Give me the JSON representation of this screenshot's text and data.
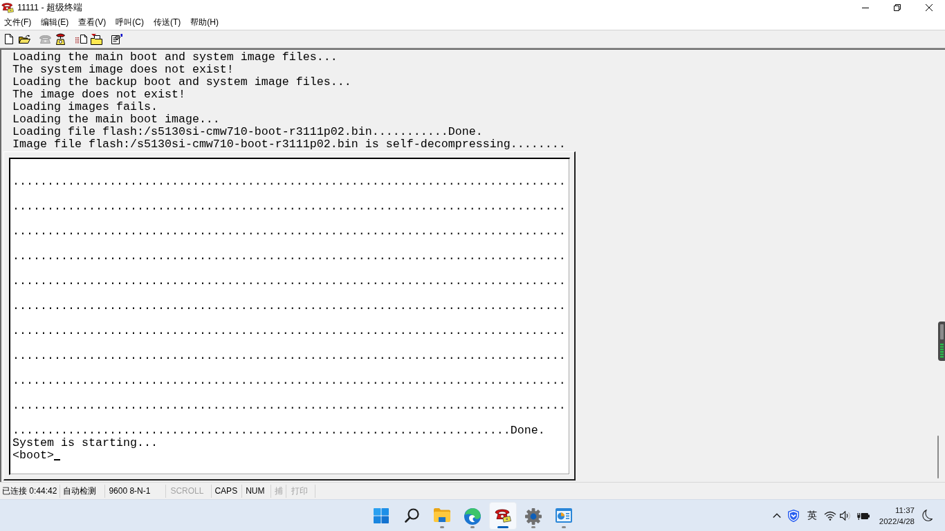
{
  "window": {
    "title": "11111 - 超级终端"
  },
  "menu": [
    "文件(F)",
    "编辑(E)",
    "查看(V)",
    "呼叫(C)",
    "传送(T)",
    "帮助(H)"
  ],
  "toolbar": {
    "groups": [
      [
        {
          "kind": "new",
          "disabled": false
        },
        {
          "kind": "open",
          "disabled": false
        }
      ],
      [
        {
          "kind": "call",
          "disabled": true
        },
        {
          "kind": "disconnect",
          "disabled": false
        }
      ],
      [
        {
          "kind": "send",
          "disabled": false
        },
        {
          "kind": "receive",
          "disabled": false
        }
      ],
      [
        {
          "kind": "properties",
          "disabled": false
        }
      ]
    ]
  },
  "terminal": {
    "history": [
      "Loading the main boot and system image files...",
      "The system image does not exist!",
      "Loading the backup boot and system image files...",
      "The image does not exist!",
      "Loading images fails.",
      "Loading the main boot image...",
      "Loading file flash:/s5130si-cmw710-boot-r3111p02.bin...........Done.",
      "Image file flash:/s5130si-cmw710-boot-r3111p02.bin is self-decompressing........"
    ],
    "screen": [
      {
        "kind": "wrapped",
        "text": "................................................................................"
      },
      {
        "kind": "wrapped",
        "text": "................................................................................"
      },
      {
        "kind": "wrapped",
        "text": "................................................................................"
      },
      {
        "kind": "wrapped",
        "text": "................................................................................"
      },
      {
        "kind": "wrapped",
        "text": "................................................................................"
      },
      {
        "kind": "wrapped",
        "text": "................................................................................"
      },
      {
        "kind": "wrapped",
        "text": "................................................................................"
      },
      {
        "kind": "wrapped",
        "text": "................................................................................"
      },
      {
        "kind": "wrapped",
        "text": "................................................................................"
      },
      {
        "kind": "wrapped",
        "text": "................................................................................"
      },
      {
        "kind": "line",
        "text": "........................................................................Done."
      },
      {
        "kind": "line",
        "text": "System is starting..."
      },
      {
        "kind": "line",
        "text": "<boot>"
      }
    ],
    "cursor": true
  },
  "status_bar": [
    {
      "text": "已连接 0:44:42",
      "disabled": false
    },
    {
      "text": "自动检测",
      "disabled": false
    },
    {
      "text": "9600 8-N-1",
      "disabled": false
    },
    {
      "text": "SCROLL",
      "disabled": true
    },
    {
      "text": "CAPS",
      "disabled": false
    },
    {
      "text": "NUM",
      "disabled": false
    },
    {
      "text": "捕",
      "disabled": true
    },
    {
      "text": "打印",
      "disabled": true
    }
  ],
  "taskbar": {
    "apps": [
      {
        "kind": "start",
        "running": false,
        "selected": false
      },
      {
        "kind": "search",
        "running": false,
        "selected": false
      },
      {
        "kind": "files",
        "running": true,
        "selected": false
      },
      {
        "kind": "browser",
        "running": true,
        "selected": false
      },
      {
        "kind": "terminal",
        "running": true,
        "selected": true
      },
      {
        "kind": "settings",
        "running": true,
        "selected": false
      },
      {
        "kind": "panel",
        "running": true,
        "selected": false
      }
    ],
    "tray": {
      "input_method": "英",
      "time": "11:37",
      "date": "2022/4/28"
    }
  }
}
